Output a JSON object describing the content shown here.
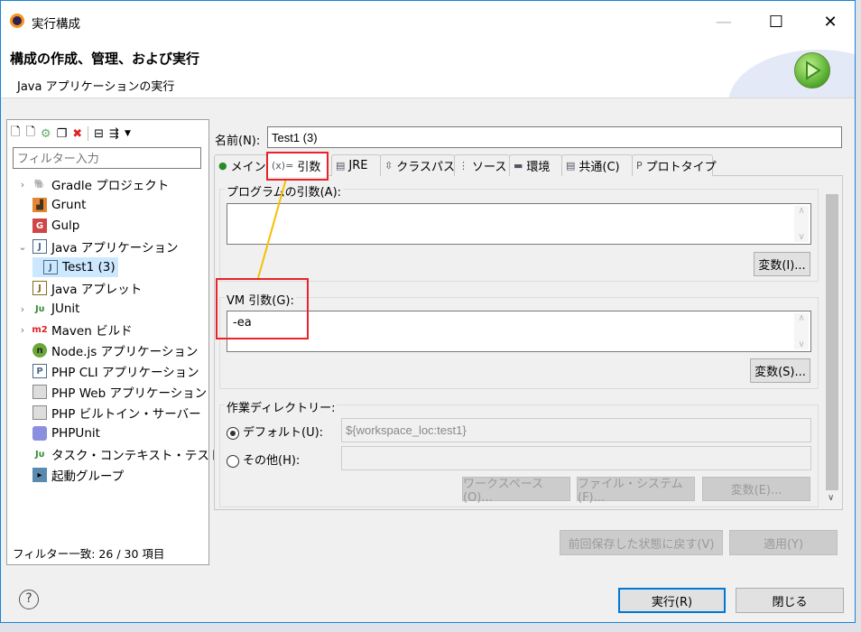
{
  "window": {
    "title": "実行構成",
    "minimize": "—",
    "maximize": "☐",
    "close": "✕"
  },
  "header": {
    "title": "構成の作成、管理、および実行",
    "subtitle": "Java アプリケーションの実行",
    "run_icon": "green-play-icon"
  },
  "left": {
    "toolbar_icons": [
      "new-config-icon",
      "new-prototype-icon",
      "export-icon",
      "duplicate-icon",
      "delete-icon",
      "collapse-all-icon",
      "filter-icon",
      "dropdown-icon"
    ],
    "filter_placeholder": "フィルター入力",
    "tree": [
      {
        "label": "Gradle プロジェクト",
        "icon": "gradle-icon",
        "expander": "›"
      },
      {
        "label": "Grunt",
        "icon": "grunt-icon"
      },
      {
        "label": "Gulp",
        "icon": "gulp-icon"
      },
      {
        "label": "Java アプリケーション",
        "icon": "java-app-icon",
        "expander": "⌄"
      },
      {
        "label": "Test1 (3)",
        "icon": "java-app-icon",
        "selected": true
      },
      {
        "label": "Java アプレット",
        "icon": "java-applet-icon"
      },
      {
        "label": "JUnit",
        "icon": "junit-icon",
        "expander": "›"
      },
      {
        "label": "Maven ビルド",
        "icon": "maven-icon",
        "expander": "›"
      },
      {
        "label": "Node.js アプリケーション",
        "icon": "nodejs-icon"
      },
      {
        "label": "PHP CLI アプリケーション",
        "icon": "php-cli-icon"
      },
      {
        "label": "PHP Web アプリケーション",
        "icon": "php-web-icon"
      },
      {
        "label": "PHP ビルトイン・サーバー",
        "icon": "php-server-icon"
      },
      {
        "label": "PHPUnit",
        "icon": "phpunit-icon"
      },
      {
        "label": "タスク・コンテキスト・テスト",
        "icon": "task-context-icon"
      },
      {
        "label": "起動グループ",
        "icon": "launch-group-icon"
      }
    ],
    "footer": "フィルター一致: 26 / 30 項目"
  },
  "main": {
    "name_label": "名前(N):",
    "name_value": "Test1 (3)",
    "tabs": [
      {
        "label": "メイン",
        "icon": "main-icon"
      },
      {
        "label": "引数",
        "icon": "arguments-icon",
        "prefix": "(x)=",
        "active": true
      },
      {
        "label": "JRE",
        "icon": "jre-icon"
      },
      {
        "label": "クラスパス",
        "icon": "classpath-icon"
      },
      {
        "label": "ソース",
        "icon": "source-icon"
      },
      {
        "label": "環境",
        "icon": "environment-icon"
      },
      {
        "label": "共通(C)",
        "icon": "common-icon"
      },
      {
        "label": "プロトタイプ",
        "icon": "prototype-icon"
      }
    ],
    "program_args": {
      "label": "プログラムの引数(A):",
      "value": "",
      "button": "変数(I)..."
    },
    "vm_args": {
      "label": "VM 引数(G):",
      "value": "-ea",
      "button": "変数(S)..."
    },
    "workdir": {
      "label": "作業ディレクトリー:",
      "default_label": "デフォルト(U):",
      "default_value": "${workspace_loc:test1}",
      "default_selected": true,
      "other_label": "その他(H):",
      "other_value": "",
      "buttons": [
        "ワークスペース(O)...",
        "ファイル・システム(F)...",
        "変数(E)..."
      ]
    },
    "revert_button": "前回保存した状態に戻す(V)",
    "apply_button": "適用(Y)"
  },
  "footer": {
    "help": "?",
    "run_button": "実行(R)",
    "close_button": "閉じる"
  },
  "colors": {
    "annotation_red": "#e8232b",
    "annotation_yellow": "#f5c000",
    "accent": "#0078d7"
  }
}
